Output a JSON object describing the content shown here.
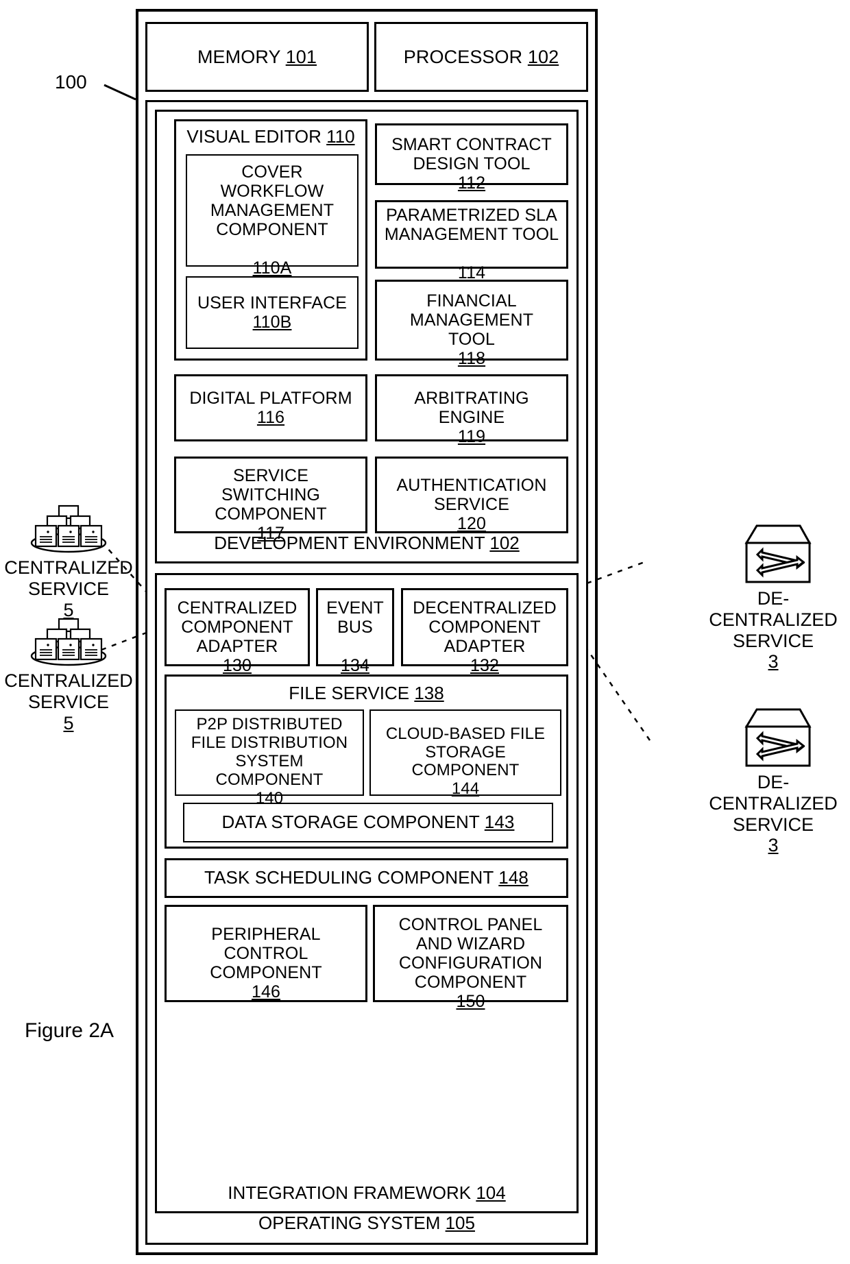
{
  "figure": {
    "label": "Figure 2A",
    "system_ref": "100"
  },
  "hardware": [
    {
      "label": "MEMORY",
      "ref": "101",
      "name": "memory-box"
    },
    {
      "label": "PROCESSOR",
      "ref": "102",
      "name": "processor-box"
    }
  ],
  "development_environment": {
    "caption": "DEVELOPMENT ENVIRONMENT",
    "caption_ref": "102",
    "visual_editor": {
      "label": "VISUAL EDITOR",
      "ref": "110",
      "children": [
        {
          "label": "COVER\nWORKFLOW\nMANAGEMENT\nCOMPONENT",
          "ref": "110A",
          "name": "cover-workflow-management-component-box"
        },
        {
          "label": "USER INTERFACE",
          "ref": "110B",
          "name": "user-interface-box"
        }
      ]
    },
    "right_column": [
      {
        "label": "SMART CONTRACT\nDESIGN TOOL",
        "ref": "112",
        "name": "smart-contract-design-tool-box"
      },
      {
        "label": "PARAMETRIZED SLA\nMANAGEMENT TOOL",
        "ref": "114",
        "name": "parametrized-sla-management-tool-box"
      },
      {
        "label": "FINANCIAL\nMANAGEMENT\nTOOL",
        "ref": "118",
        "name": "financial-management-tool-box"
      }
    ],
    "lower_rows": [
      {
        "label": "DIGITAL PLATFORM",
        "ref": "116",
        "name": "digital-platform-box"
      },
      {
        "label": "ARBITRATING\nENGINE",
        "ref": "119",
        "name": "arbitrating-engine-box"
      },
      {
        "label": "SERVICE\nSWITCHING\nCOMPONENT",
        "ref": "117",
        "name": "service-switching-component-box"
      },
      {
        "label": "AUTHENTICATION\nSERVICE",
        "ref": "120",
        "name": "authentication-service-box"
      }
    ]
  },
  "integration_framework": {
    "caption": "INTEGRATION FRAMEWORK",
    "caption_ref": "104",
    "adapters": [
      {
        "label": "CENTRALIZED\nCOMPONENT\nADAPTER",
        "ref": "130",
        "name": "centralized-component-adapter-box"
      },
      {
        "label": "EVENT\nBUS",
        "ref": "134",
        "name": "event-bus-box"
      },
      {
        "label": "DECENTRALIZED\nCOMPONENT\nADAPTER",
        "ref": "132",
        "name": "decentralized-component-adapter-box"
      }
    ],
    "file_service": {
      "label": "FILE SERVICE",
      "ref": "138",
      "children": [
        {
          "label": "P2P DISTRIBUTED\nFILE DISTRIBUTION\nSYSTEM\nCOMPONENT",
          "ref": "140",
          "name": "p2p-distributed-file-distribution-system-component-box"
        },
        {
          "label": "CLOUD-BASED FILE\nSTORAGE\nCOMPONENT",
          "ref": "144",
          "name": "cloud-based-file-storage-component-box"
        },
        {
          "label": "DATA STORAGE COMPONENT",
          "ref": "143",
          "name": "data-storage-component-box"
        }
      ]
    },
    "task_scheduling": {
      "label": "TASK SCHEDULING COMPONENT",
      "ref": "148",
      "name": "task-scheduling-component-box"
    },
    "bottom_row": [
      {
        "label": "PERIPHERAL\nCONTROL\nCOMPONENT",
        "ref": "146",
        "name": "peripheral-control-component-box"
      },
      {
        "label": "CONTROL PANEL\nAND WIZARD\nCONFIGURATION\nCOMPONENT",
        "ref": "150",
        "name": "control-panel-and-wizard-configuration-component-box"
      }
    ]
  },
  "operating_system": {
    "caption": "OPERATING SYSTEM",
    "caption_ref": "105"
  },
  "external_services": {
    "centralized": [
      {
        "label": "CENTRALIZED\nSERVICE",
        "ref": "5",
        "icon": "server-cluster-icon",
        "name": "centralized-service-1"
      },
      {
        "label": "CENTRALIZED\nSERVICE",
        "ref": "5",
        "icon": "server-cluster-icon",
        "name": "centralized-service-2"
      }
    ],
    "decentralized": [
      {
        "label": "DE-\nCENTRALIZED\nSERVICE",
        "ref": "3",
        "icon": "network-switch-icon",
        "name": "decentralized-service-1"
      },
      {
        "label": "DE-\nCENTRALIZED\nSERVICE",
        "ref": "3",
        "icon": "network-switch-icon",
        "name": "decentralized-service-2"
      }
    ]
  },
  "colors": {
    "line": "#000000",
    "background": "#ffffff"
  }
}
